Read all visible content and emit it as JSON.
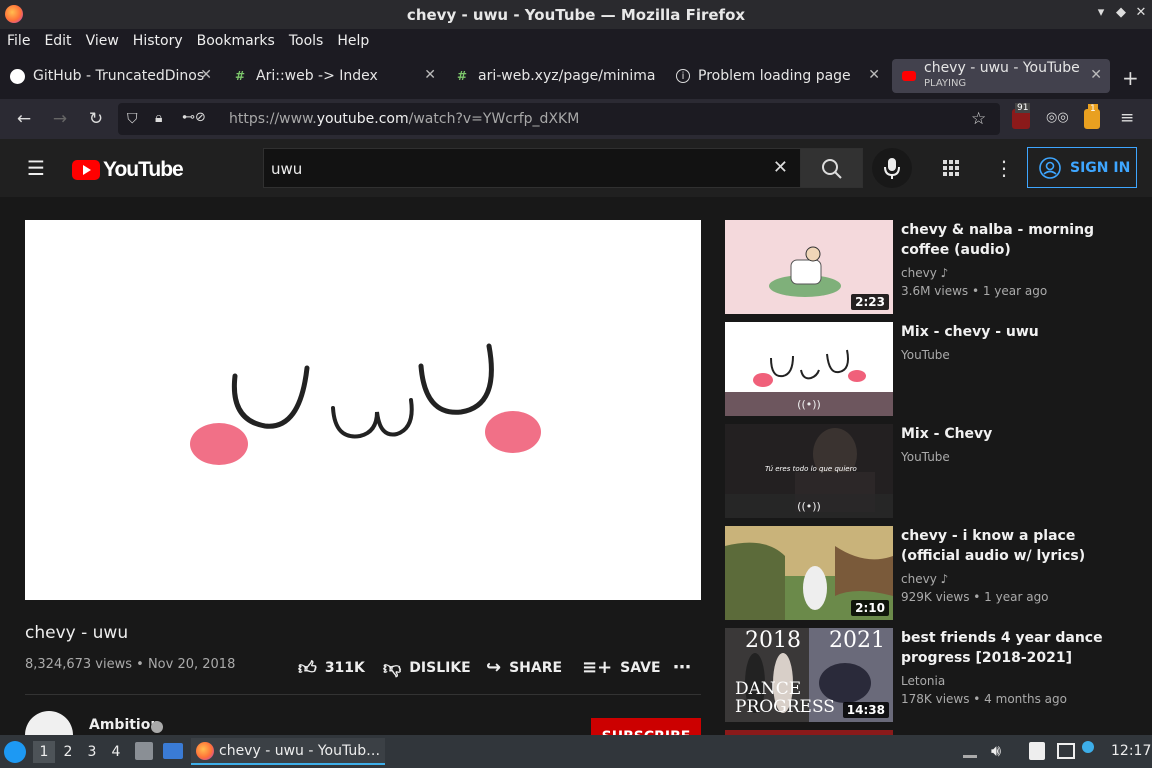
{
  "window": {
    "title": "chevy - uwu - YouTube — Mozilla Firefox"
  },
  "menu": [
    "File",
    "Edit",
    "View",
    "History",
    "Bookmarks",
    "Tools",
    "Help"
  ],
  "tabs": [
    {
      "label": "GitHub - TruncatedDinos"
    },
    {
      "label": "Ari::web -> Index"
    },
    {
      "label": "ari-web.xyz/page/minima"
    },
    {
      "label": "Problem loading page"
    },
    {
      "label": "chevy - uwu - YouTube",
      "sub": "PLAYING"
    }
  ],
  "navbar": {
    "url_prefix": "https://www.",
    "url_domain": "youtube.com",
    "url_path": "/watch?v=YWcrfp_dXKM",
    "ext_badge_1": "91",
    "ext_badge_2": "1"
  },
  "youtube": {
    "logo_text": "YouTube",
    "search_value": "uwu",
    "signin_label": "SIGN IN"
  },
  "video": {
    "title": "chevy - uwu",
    "views": "8,324,673 views",
    "date": "Nov 20, 2018",
    "likes": "311K",
    "dislike_label": "DISLIKE",
    "share_label": "SHARE",
    "save_label": "SAVE",
    "channel": "Ambition",
    "subscribe_label": "SUBSCRIBE"
  },
  "recommendations": [
    {
      "title": "chevy & nalba - morning coffee (audio)",
      "channel": "chevy",
      "views": "3.6M views • 1 year ago",
      "duration": "2:23"
    },
    {
      "title": "Mix - chevy - uwu",
      "channel": "YouTube",
      "views": "",
      "duration": ""
    },
    {
      "title": "Mix - Chevy",
      "channel": "YouTube",
      "views": "",
      "duration": "",
      "thumb_caption": "Tú eres todo lo que quiero"
    },
    {
      "title": "chevy - i know a place (official audio w/ lyrics)",
      "channel": "chevy",
      "views": "929K views • 1 year ago",
      "duration": "2:10"
    },
    {
      "title": "best friends 4 year dance progress [2018-2021]",
      "channel": "Letonia",
      "views": "178K views • 4 months ago",
      "duration": "14:38",
      "thumb_year_1": "2018",
      "thumb_year_2": "2021",
      "thumb_text": "DANCE PROGRESS"
    }
  ],
  "taskbar": {
    "workspaces": [
      "1",
      "2",
      "3",
      "4"
    ],
    "task_label": "chevy - uwu - YouTub…",
    "clock": "12:17"
  }
}
